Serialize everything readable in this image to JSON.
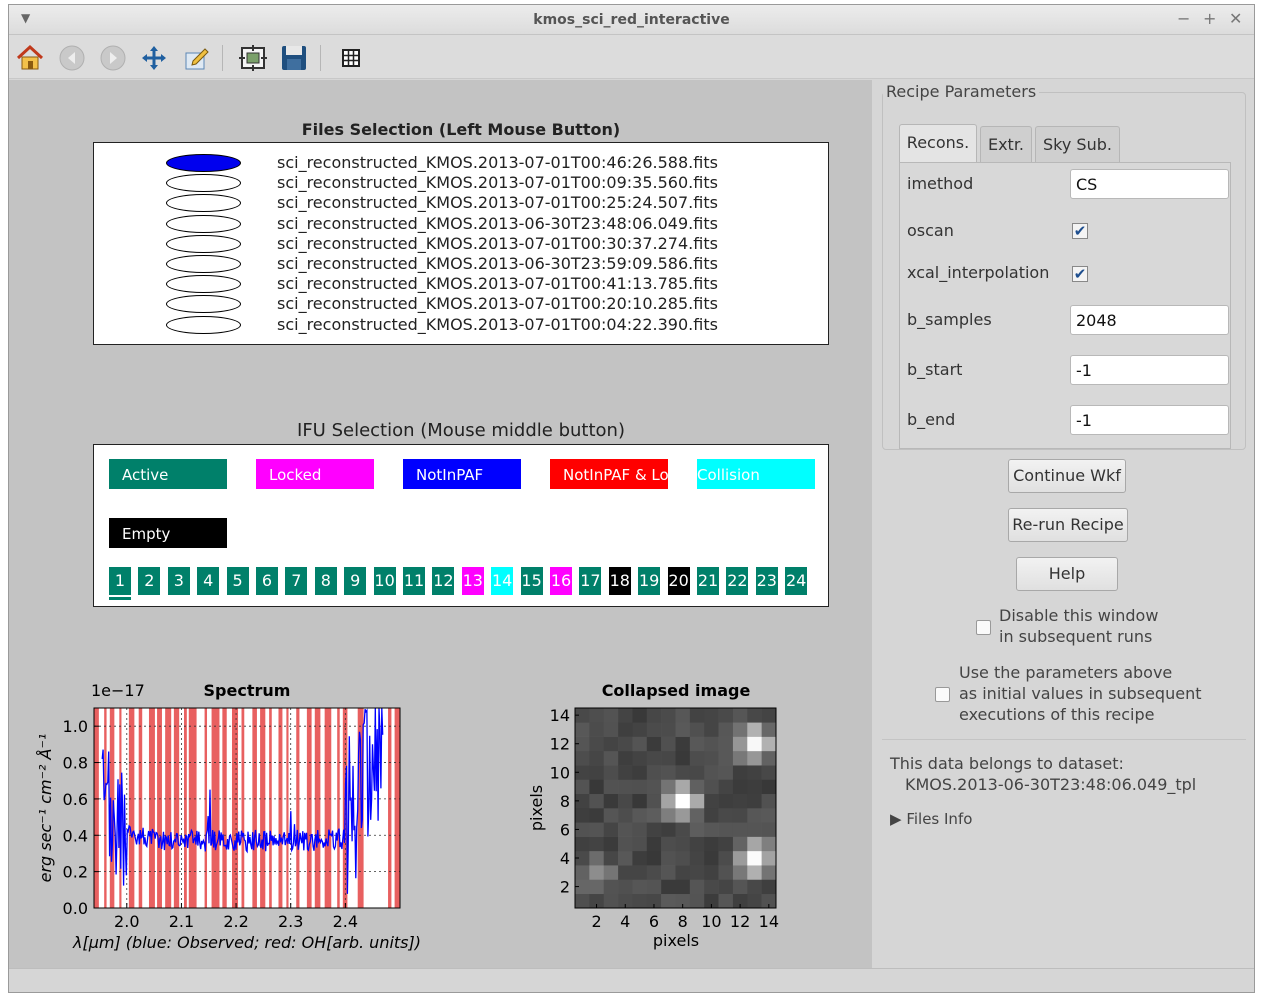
{
  "window": {
    "title": "kmos_sci_red_interactive"
  },
  "toolbar": {
    "items": [
      "home-icon",
      "back-icon",
      "forward-icon",
      "pan-icon",
      "edit-axis-icon",
      "configure-subplots-icon",
      "save-icon",
      "grid-icon"
    ]
  },
  "files_panel": {
    "title": "Files Selection (Left Mouse Button)",
    "selected_index": 0,
    "files": [
      "sci_reconstructed_KMOS.2013-07-01T00:46:26.588.fits",
      "sci_reconstructed_KMOS.2013-07-01T00:09:35.560.fits",
      "sci_reconstructed_KMOS.2013-07-01T00:25:24.507.fits",
      "sci_reconstructed_KMOS.2013-06-30T23:48:06.049.fits",
      "sci_reconstructed_KMOS.2013-07-01T00:30:37.274.fits",
      "sci_reconstructed_KMOS.2013-06-30T23:59:09.586.fits",
      "sci_reconstructed_KMOS.2013-07-01T00:41:13.785.fits",
      "sci_reconstructed_KMOS.2013-07-01T00:20:10.285.fits",
      "sci_reconstructed_KMOS.2013-07-01T00:04:22.390.fits"
    ]
  },
  "ifu_panel": {
    "title": "IFU Selection (Mouse middle button)",
    "legend": [
      {
        "label": "Active",
        "color": "#00806a",
        "text_color": "#ffffff"
      },
      {
        "label": "Locked",
        "color": "#ff00ff",
        "text_color": "#ffffff"
      },
      {
        "label": "NotInPAF",
        "color": "#0000ff",
        "text_color": "#ffffff"
      },
      {
        "label": "NotInPAF & Locked",
        "color": "#ff0000",
        "text_color": "#ffffff"
      },
      {
        "label": "Collision",
        "color": "#00ffff",
        "text_color": "#ffffff"
      },
      {
        "label": "Empty",
        "color": "#000000",
        "text_color": "#ffffff"
      }
    ],
    "selected_ifu": "1",
    "ifus": [
      {
        "n": "1",
        "state": "Active"
      },
      {
        "n": "2",
        "state": "Active"
      },
      {
        "n": "3",
        "state": "Active"
      },
      {
        "n": "4",
        "state": "Active"
      },
      {
        "n": "5",
        "state": "Active"
      },
      {
        "n": "6",
        "state": "Active"
      },
      {
        "n": "7",
        "state": "Active"
      },
      {
        "n": "8",
        "state": "Active"
      },
      {
        "n": "9",
        "state": "Active"
      },
      {
        "n": "10",
        "state": "Active"
      },
      {
        "n": "11",
        "state": "Active"
      },
      {
        "n": "12",
        "state": "Active"
      },
      {
        "n": "13",
        "state": "Locked"
      },
      {
        "n": "14",
        "state": "Collision"
      },
      {
        "n": "15",
        "state": "Active"
      },
      {
        "n": "16",
        "state": "Locked"
      },
      {
        "n": "17",
        "state": "Active"
      },
      {
        "n": "18",
        "state": "Empty"
      },
      {
        "n": "19",
        "state": "Active"
      },
      {
        "n": "20",
        "state": "Empty"
      },
      {
        "n": "21",
        "state": "Active"
      },
      {
        "n": "22",
        "state": "Active"
      },
      {
        "n": "23",
        "state": "Active"
      },
      {
        "n": "24",
        "state": "Active"
      }
    ]
  },
  "spectrum": {
    "title": "Spectrum",
    "offset_text": "1e−17",
    "ylabel": "erg sec⁻¹ cm⁻² Å⁻¹",
    "xlabel": "λ[μm] (blue: Observed; red: OH[arb. units])",
    "yticks": [
      "0.0",
      "0.2",
      "0.4",
      "0.6",
      "0.8",
      "1.0"
    ],
    "xticks": [
      "2.0",
      "2.1",
      "2.2",
      "2.3",
      "2.4"
    ]
  },
  "collapsed": {
    "title": "Collapsed image",
    "xlabel": "pixels",
    "ylabel": "pixels",
    "ticks": [
      "2",
      "4",
      "6",
      "8",
      "10",
      "12",
      "14"
    ]
  },
  "chart_data": [
    {
      "type": "line",
      "title": "Spectrum",
      "xlabel": "λ[μm] (blue: Observed; red: OH[arb. units])",
      "ylabel": "erg sec⁻¹ cm⁻² Å⁻¹",
      "xlim": [
        1.94,
        2.5
      ],
      "ylim": [
        0.0,
        1.1
      ],
      "y_scale_factor": "1e-17",
      "grid": true,
      "series": [
        {
          "name": "Observed",
          "color": "#0000ff",
          "x": [
            1.96,
            1.98,
            2.0,
            2.02,
            2.05,
            2.1,
            2.15,
            2.2,
            2.25,
            2.3,
            2.35,
            2.4,
            2.42,
            2.44,
            2.46
          ],
          "y": [
            0.55,
            0.45,
            0.42,
            0.4,
            0.38,
            0.37,
            0.37,
            0.37,
            0.37,
            0.37,
            0.37,
            0.38,
            0.5,
            0.7,
            0.9
          ]
        },
        {
          "name": "OH",
          "color": "#e05050",
          "note": "sky line regions, arbitrary units"
        }
      ]
    },
    {
      "type": "heatmap",
      "title": "Collapsed image",
      "xlabel": "pixels",
      "ylabel": "pixels",
      "xlim": [
        0.5,
        14.5
      ],
      "ylim": [
        0.5,
        14.5
      ],
      "colormap": "gray",
      "bright_regions": [
        {
          "x": 8,
          "y": 8,
          "level": "high"
        },
        {
          "x": 13,
          "y": 12,
          "level": "high"
        },
        {
          "x": 13,
          "y": 4,
          "level": "high"
        },
        {
          "x": 2,
          "y": 3,
          "level": "medium"
        }
      ]
    }
  ],
  "right_panel": {
    "group_title": "Recipe Parameters",
    "tabs": [
      "Recons.",
      "Extr.",
      "Sky Sub."
    ],
    "active_tab": "Recons.",
    "params": [
      {
        "name": "imethod",
        "type": "text",
        "value": "CS"
      },
      {
        "name": "oscan",
        "type": "check",
        "checked": "✔"
      },
      {
        "name": "xcal_interpolation",
        "type": "check",
        "checked": "✔"
      },
      {
        "name": "b_samples",
        "type": "text",
        "value": "2048"
      },
      {
        "name": "b_start",
        "type": "text",
        "value": "-1"
      },
      {
        "name": "b_end",
        "type": "text",
        "value": "-1"
      }
    ],
    "buttons": {
      "continue": "Continue Wkf",
      "rerun": "Re-run Recipe",
      "help": "Help"
    },
    "disable_window": {
      "line1": "Disable this window",
      "line2": "in subsequent runs"
    },
    "use_params": {
      "line1": "Use the parameters above",
      "line2": "as initial values in subsequent",
      "line3": "executions of this recipe"
    },
    "dataset": {
      "label": "This data belongs to dataset:",
      "name": "KMOS.2013-06-30T23:48:06.049_tpl"
    },
    "files_info": "Files Info"
  }
}
